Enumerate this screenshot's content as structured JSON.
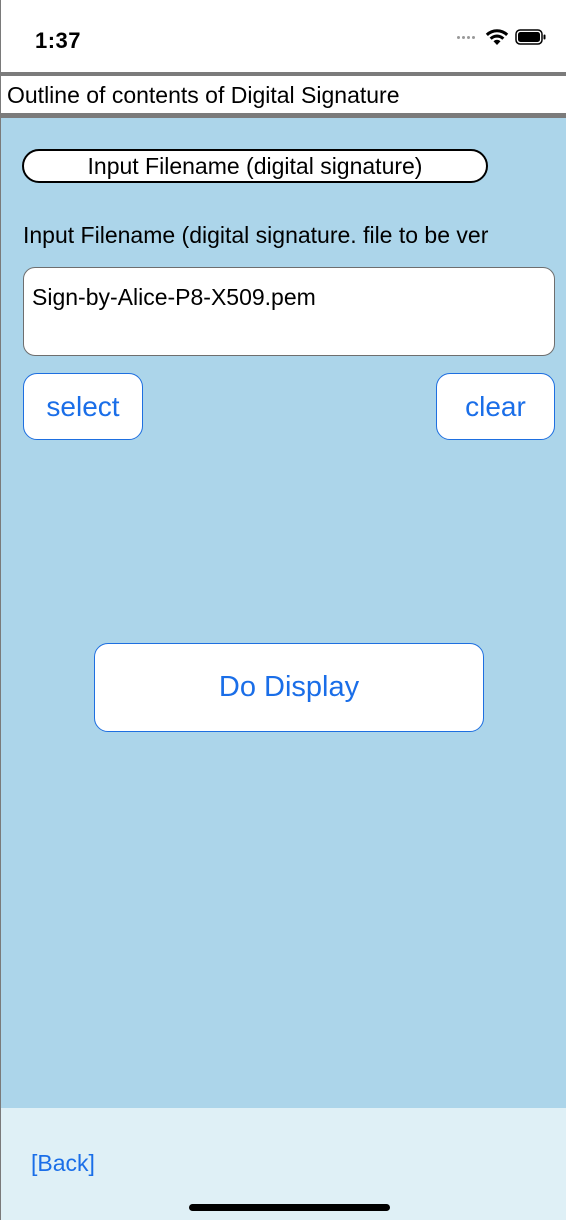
{
  "status_bar": {
    "time": "1:37",
    "icons": [
      "cellular-signal-icon",
      "wifi-icon",
      "battery-icon"
    ]
  },
  "header": {
    "title": "Outline of contents of Digital Signature"
  },
  "main": {
    "section_title": "Input Filename (digital signature)",
    "field_label": "Input Filename (digital signature. file to be ver",
    "filename_value": "Sign-by-Alice-P8-X509.pem",
    "select_label": "select",
    "clear_label": "clear",
    "display_label": "Do Display"
  },
  "footer": {
    "back_label": "[Back]"
  },
  "colors": {
    "background": "#acd5ea",
    "footer_background": "#dff0f6",
    "accent": "#1a6ee8"
  }
}
